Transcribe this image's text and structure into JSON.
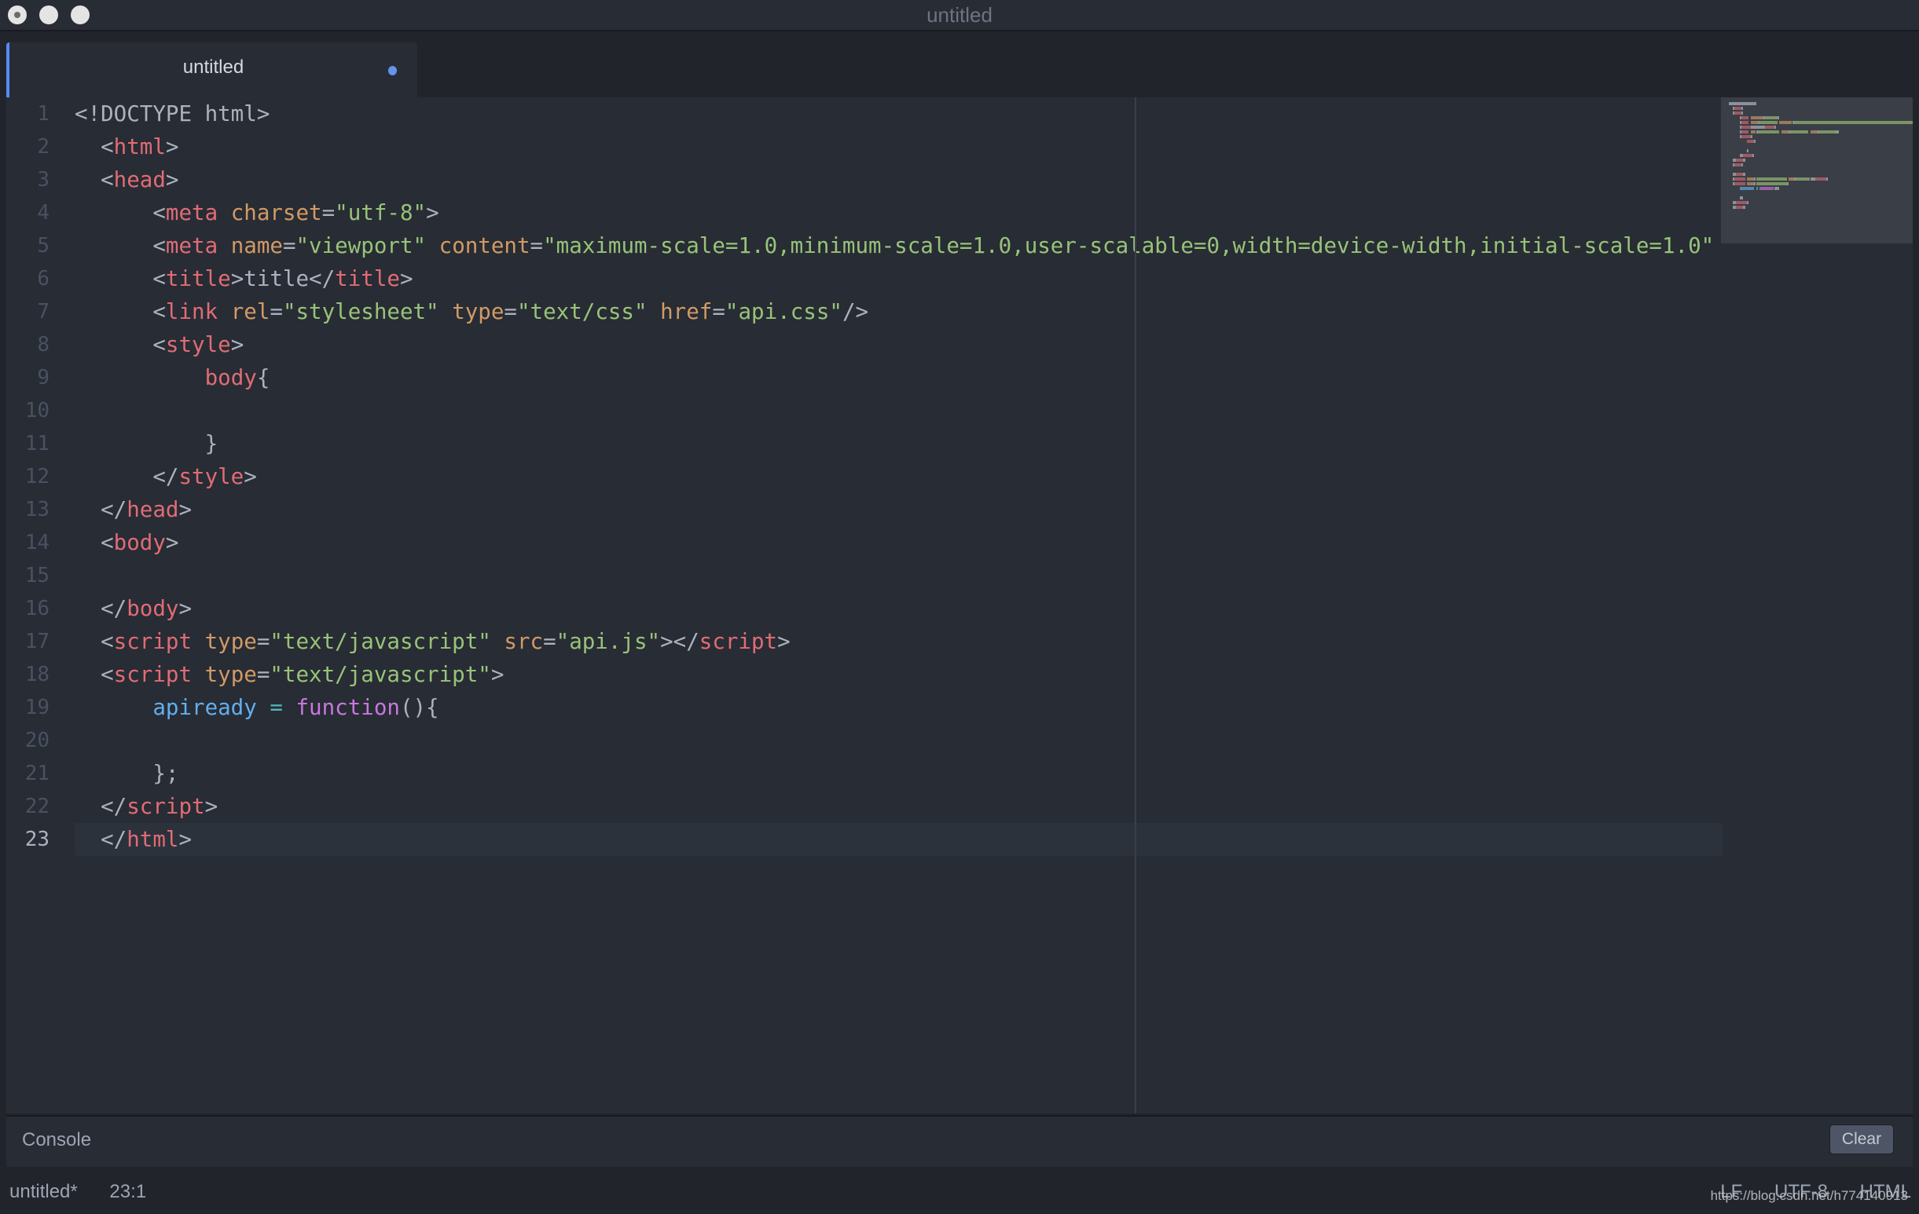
{
  "window": {
    "title": "untitled",
    "controls": [
      "close",
      "minimize",
      "maximize"
    ]
  },
  "tabs": [
    {
      "label": "untitled",
      "modified": true,
      "active": true
    }
  ],
  "editor": {
    "active_line": 23,
    "lines": [
      {
        "n": "1",
        "tokens": [
          [
            "pun",
            "<!DOCTYPE html>"
          ]
        ]
      },
      {
        "n": "2",
        "tokens": [
          [
            "pun",
            "  <"
          ],
          [
            "tag",
            "html"
          ],
          [
            "pun",
            ">"
          ]
        ]
      },
      {
        "n": "3",
        "tokens": [
          [
            "pun",
            "  <"
          ],
          [
            "tag",
            "head"
          ],
          [
            "pun",
            ">"
          ]
        ]
      },
      {
        "n": "4",
        "tokens": [
          [
            "pun",
            "      <"
          ],
          [
            "tag",
            "meta"
          ],
          [
            "pun",
            " "
          ],
          [
            "attr",
            "charset"
          ],
          [
            "pun",
            "="
          ],
          [
            "str",
            "\"utf-8\""
          ],
          [
            "pun",
            ">"
          ]
        ]
      },
      {
        "n": "5",
        "tokens": [
          [
            "pun",
            "      <"
          ],
          [
            "tag",
            "meta"
          ],
          [
            "pun",
            " "
          ],
          [
            "attr",
            "name"
          ],
          [
            "pun",
            "="
          ],
          [
            "str",
            "\"viewport\""
          ],
          [
            "pun",
            " "
          ],
          [
            "attr",
            "content"
          ],
          [
            "pun",
            "="
          ],
          [
            "str",
            "\"maximum-scale=1.0,minimum-scale=1.0,user-scalable=0,width=device-width,initial-scale=1.0\""
          ]
        ]
      },
      {
        "n": "6",
        "tokens": [
          [
            "pun",
            "      <"
          ],
          [
            "tag",
            "title"
          ],
          [
            "pun",
            ">title</"
          ],
          [
            "tag",
            "title"
          ],
          [
            "pun",
            ">"
          ]
        ]
      },
      {
        "n": "7",
        "tokens": [
          [
            "pun",
            "      <"
          ],
          [
            "tag",
            "link"
          ],
          [
            "pun",
            " "
          ],
          [
            "attr",
            "rel"
          ],
          [
            "pun",
            "="
          ],
          [
            "str",
            "\"stylesheet\""
          ],
          [
            "pun",
            " "
          ],
          [
            "attr",
            "type"
          ],
          [
            "pun",
            "="
          ],
          [
            "str",
            "\"text/css\""
          ],
          [
            "pun",
            " "
          ],
          [
            "attr",
            "href"
          ],
          [
            "pun",
            "="
          ],
          [
            "str",
            "\"api.css\""
          ],
          [
            "pun",
            "/>"
          ]
        ]
      },
      {
        "n": "8",
        "tokens": [
          [
            "pun",
            "      <"
          ],
          [
            "tag",
            "style"
          ],
          [
            "pun",
            ">"
          ]
        ]
      },
      {
        "n": "9",
        "tokens": [
          [
            "pun",
            "          "
          ],
          [
            "tag",
            "body"
          ],
          [
            "pun",
            "{"
          ]
        ]
      },
      {
        "n": "10",
        "tokens": []
      },
      {
        "n": "11",
        "tokens": [
          [
            "pun",
            "          }"
          ]
        ]
      },
      {
        "n": "12",
        "tokens": [
          [
            "pun",
            "      </"
          ],
          [
            "tag",
            "style"
          ],
          [
            "pun",
            ">"
          ]
        ]
      },
      {
        "n": "13",
        "tokens": [
          [
            "pun",
            "  </"
          ],
          [
            "tag",
            "head"
          ],
          [
            "pun",
            ">"
          ]
        ]
      },
      {
        "n": "14",
        "tokens": [
          [
            "pun",
            "  <"
          ],
          [
            "tag",
            "body"
          ],
          [
            "pun",
            ">"
          ]
        ]
      },
      {
        "n": "15",
        "tokens": []
      },
      {
        "n": "16",
        "tokens": [
          [
            "pun",
            "  </"
          ],
          [
            "tag",
            "body"
          ],
          [
            "pun",
            ">"
          ]
        ]
      },
      {
        "n": "17",
        "tokens": [
          [
            "pun",
            "  <"
          ],
          [
            "tag",
            "script"
          ],
          [
            "pun",
            " "
          ],
          [
            "attr",
            "type"
          ],
          [
            "pun",
            "="
          ],
          [
            "str",
            "\"text/javascript\""
          ],
          [
            "pun",
            " "
          ],
          [
            "attr",
            "src"
          ],
          [
            "pun",
            "="
          ],
          [
            "str",
            "\"api.js\""
          ],
          [
            "pun",
            "></"
          ],
          [
            "tag",
            "script"
          ],
          [
            "pun",
            ">"
          ]
        ]
      },
      {
        "n": "18",
        "tokens": [
          [
            "pun",
            "  <"
          ],
          [
            "tag",
            "script"
          ],
          [
            "pun",
            " "
          ],
          [
            "attr",
            "type"
          ],
          [
            "pun",
            "="
          ],
          [
            "str",
            "\"text/javascript\""
          ],
          [
            "pun",
            ">"
          ]
        ]
      },
      {
        "n": "19",
        "tokens": [
          [
            "pun",
            "      "
          ],
          [
            "var",
            "apiready"
          ],
          [
            "pun",
            " "
          ],
          [
            "op",
            "="
          ],
          [
            "pun",
            " "
          ],
          [
            "kw",
            "function"
          ],
          [
            "pun",
            "(){"
          ]
        ]
      },
      {
        "n": "20",
        "tokens": []
      },
      {
        "n": "21",
        "tokens": [
          [
            "pun",
            "      };"
          ]
        ]
      },
      {
        "n": "22",
        "tokens": [
          [
            "pun",
            "  </"
          ],
          [
            "tag",
            "script"
          ],
          [
            "pun",
            ">"
          ]
        ]
      },
      {
        "n": "23",
        "tokens": [
          [
            "pun",
            "  </"
          ],
          [
            "tag",
            "html"
          ],
          [
            "pun",
            ">"
          ]
        ]
      }
    ]
  },
  "console": {
    "label": "Console",
    "clear_label": "Clear"
  },
  "status": {
    "file": "untitled*",
    "cursor": "23:1",
    "line_ending": "LF",
    "encoding": "UTF-8",
    "grammar": "HTML"
  },
  "watermark": "https://blog.csdn.net/h774140913",
  "colors": {
    "accent": "#568af2",
    "modified_dot": "#6494ed",
    "tag": "#e06c75",
    "attribute": "#d19a66",
    "string": "#98c379",
    "variable": "#61afef",
    "operator": "#56b6c2",
    "keyword": "#c678dd",
    "text": "#abb2bf"
  }
}
